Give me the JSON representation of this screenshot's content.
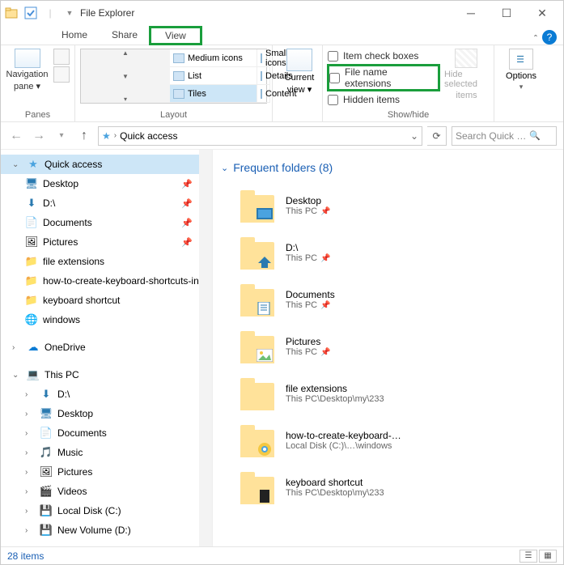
{
  "window": {
    "title": "File Explorer"
  },
  "tabs": {
    "home": "Home",
    "share": "Share",
    "view": "View"
  },
  "ribbon": {
    "panes_label": "Panes",
    "navigation_label": "Navigation",
    "navigation_sub": "pane ▾",
    "layout_label": "Layout",
    "layout_options": {
      "medium": "Medium icons",
      "small": "Small icons",
      "list": "List",
      "details": "Details",
      "tiles": "Tiles",
      "content": "Content"
    },
    "current_view": "Current",
    "current_view_sub": "view ▾",
    "showhide_label": "Show/hide",
    "check_itemboxes": "Item check boxes",
    "check_ext": "File name extensions",
    "check_hidden": "Hidden items",
    "hide_selected": "Hide selected",
    "hide_selected_sub": "items",
    "options": "Options"
  },
  "address": {
    "location": "Quick access",
    "search_placeholder": "Search Quick …"
  },
  "tree": {
    "quick_access": "Quick access",
    "desktop": "Desktop",
    "d_drive": "D:\\",
    "documents": "Documents",
    "pictures": "Pictures",
    "file_ext": "file extensions",
    "howto": "how-to-create-keyboard-shortcuts-in-w",
    "kbshortcut": "keyboard shortcut",
    "windows": "windows",
    "onedrive": "OneDrive",
    "thispc": "This PC",
    "music": "Music",
    "videos": "Videos",
    "localc": "Local Disk (C:)",
    "newvol": "New Volume (D:)"
  },
  "content": {
    "heading": "Frequent folders (8)",
    "items": [
      {
        "name": "Desktop",
        "sub": "This PC",
        "pinned": true,
        "overlay": "monitor"
      },
      {
        "name": "D:\\",
        "sub": "This PC",
        "pinned": true,
        "overlay": "arrow"
      },
      {
        "name": "Documents",
        "sub": "This PC",
        "pinned": true,
        "overlay": "doc"
      },
      {
        "name": "Pictures",
        "sub": "This PC",
        "pinned": true,
        "overlay": "pic"
      },
      {
        "name": "file extensions",
        "sub": "This PC\\Desktop\\my\\233",
        "pinned": false,
        "overlay": ""
      },
      {
        "name": "how-to-create-keyboard-…",
        "sub": "Local Disk (C:)\\…\\windows",
        "pinned": false,
        "overlay": "chrome"
      },
      {
        "name": "keyboard shortcut",
        "sub": "This PC\\Desktop\\my\\233",
        "pinned": false,
        "overlay": "dark"
      }
    ]
  },
  "status": {
    "count": "28 items"
  }
}
